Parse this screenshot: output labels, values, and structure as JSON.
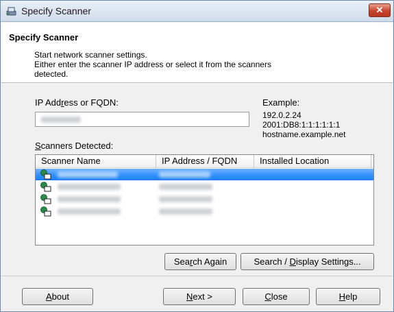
{
  "window": {
    "title": "Specify Scanner",
    "close_glyph": "✕"
  },
  "header": {
    "title": "Specify Scanner",
    "desc_line1": "Start network scanner settings.",
    "desc_line2": "Either enter the scanner IP address or select it from the scanners",
    "desc_line3": "detected."
  },
  "ip_field": {
    "label_pre": "IP Add",
    "label_u": "r",
    "label_post": "ess or FQDN:",
    "value": ""
  },
  "example": {
    "label": "Example:",
    "line1": "192.0.2.24",
    "line2": "2001:DB8:1:1:1:1:1:1",
    "line3": "hostname.example.net"
  },
  "scanners": {
    "label_u": "S",
    "label_post": "canners Detected:",
    "columns": [
      "Scanner Name",
      "IP Address / FQDN",
      "Installed Location"
    ],
    "rows": [
      {
        "name": "",
        "ip": "",
        "location": "",
        "selected": true
      },
      {
        "name": "",
        "ip": "",
        "location": "",
        "selected": false
      },
      {
        "name": "",
        "ip": "",
        "location": "",
        "selected": false
      },
      {
        "name": "",
        "ip": "",
        "location": "",
        "selected": false
      }
    ]
  },
  "buttons": {
    "search_again": {
      "pre": "Sea",
      "u": "r",
      "post": "ch Again"
    },
    "search_display": {
      "pre": "Search / ",
      "u": "D",
      "post": "isplay Settings..."
    },
    "about": {
      "u": "A",
      "post": "bout"
    },
    "next": {
      "u": "N",
      "post": "ext >"
    },
    "close": {
      "u": "C",
      "post": "lose"
    },
    "help": {
      "u": "H",
      "post": "elp"
    }
  },
  "colors": {
    "selection": "#2f8fff",
    "close_button": "#c7452c"
  },
  "icons": {
    "title": "scanner-app-icon",
    "row": "network-scanner-icon"
  }
}
